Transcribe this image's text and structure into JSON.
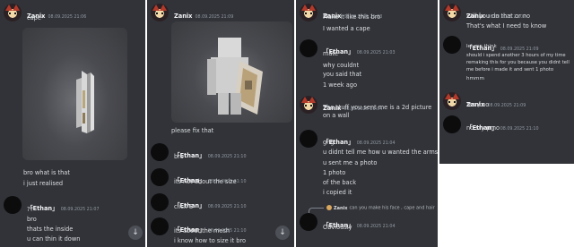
{
  "panel1": {
    "top_msg": {
      "author": "Zanix",
      "time": "08.09.2025 21:06",
      "lines": [
        "cape*"
      ]
    },
    "bottom_lines": [
      "bro what is that",
      "i just realised"
    ],
    "ethan_msg": {
      "author": "「Ethan」",
      "time": "08.09.2025 21:07",
      "lines": [
        "??",
        "bro",
        "thats the inside",
        "u can thin it down"
      ]
    }
  },
  "panel2": {
    "top_msg": {
      "author": "Zanix",
      "time": "08.09.2025 21:09"
    },
    "caption": "please fix that",
    "messages": [
      {
        "author": "「Ethan」",
        "time": "08.09.2025 21:10",
        "text": "bro"
      },
      {
        "author": "「Ethan」",
        "time": "08.09.2025 21:10",
        "text": "its not about the size"
      },
      {
        "author": "「Ethan」",
        "time": "08.09.2025 21:10",
        "text": "click S"
      },
      {
        "author": "「Ethan」",
        "time": "08.09.2025 21:10",
        "text": "its about the mesh"
      }
    ],
    "cut_line": "i know how to size it bro"
  },
  "panel3": {
    "zanix_msg": {
      "author": "Zanix",
      "time": "08.09.2025 21:03",
      "lines": [
        "Make it like this bro",
        "I wanted a cape"
      ]
    },
    "ethan_msg_1": {
      "author": "「Ethan」",
      "time": "08.09.2025 21:03",
      "lines": [
        "mate",
        "why couldnt",
        "you said that",
        "1 week ago"
      ]
    },
    "zanix_msg_2": {
      "author": "Zanix",
      "time": "08.09.2025 21:04",
      "text": "The stuff you sent me is a 2d picture on a wall"
    },
    "ethan_msg_2": {
      "author": "「Ethan」",
      "time": "08.09.2025 21:04",
      "lines": [
        "gng",
        "u didnt tell me how u wanted the arms",
        "u sent me a photo",
        "1 photo",
        "of the back",
        "i copied it"
      ]
    },
    "reply": {
      "author": "Zanix",
      "text": "can you make his face , cape and hair"
    },
    "ethan_msg_3": {
      "author": "「Ethan」",
      "time": "08.09.2025 21:04",
      "lines": [
        "Obviously"
      ]
    }
  },
  "panel4": {
    "zanix_msg": {
      "author": "Zanix",
      "time": "08.09.2025 21:07",
      "lines": [
        "Will you do that or no",
        "That's what I need to know"
      ]
    },
    "ethan_msg_1": {
      "author": "「Ethan」",
      "time": "08.09.2025 21:09",
      "lines": [
        "let me think"
      ],
      "wrapped": "should i spend another 3 hours of my time remaking this for you because you didnt tell me before i made it and sent 1 photo",
      "after": "hmmm"
    },
    "zanix_msg_2": {
      "author": "Zanix",
      "time": "08.09.2025 21:09",
      "lines": [
        "Yes / no"
      ]
    },
    "ethan_msg_2": {
      "author": "「Ethan」",
      "time": "08.09.2025 21:10",
      "lines": [
        "no sry pmo"
      ]
    }
  },
  "icons": {
    "scroll": "arrow-down-icon"
  }
}
